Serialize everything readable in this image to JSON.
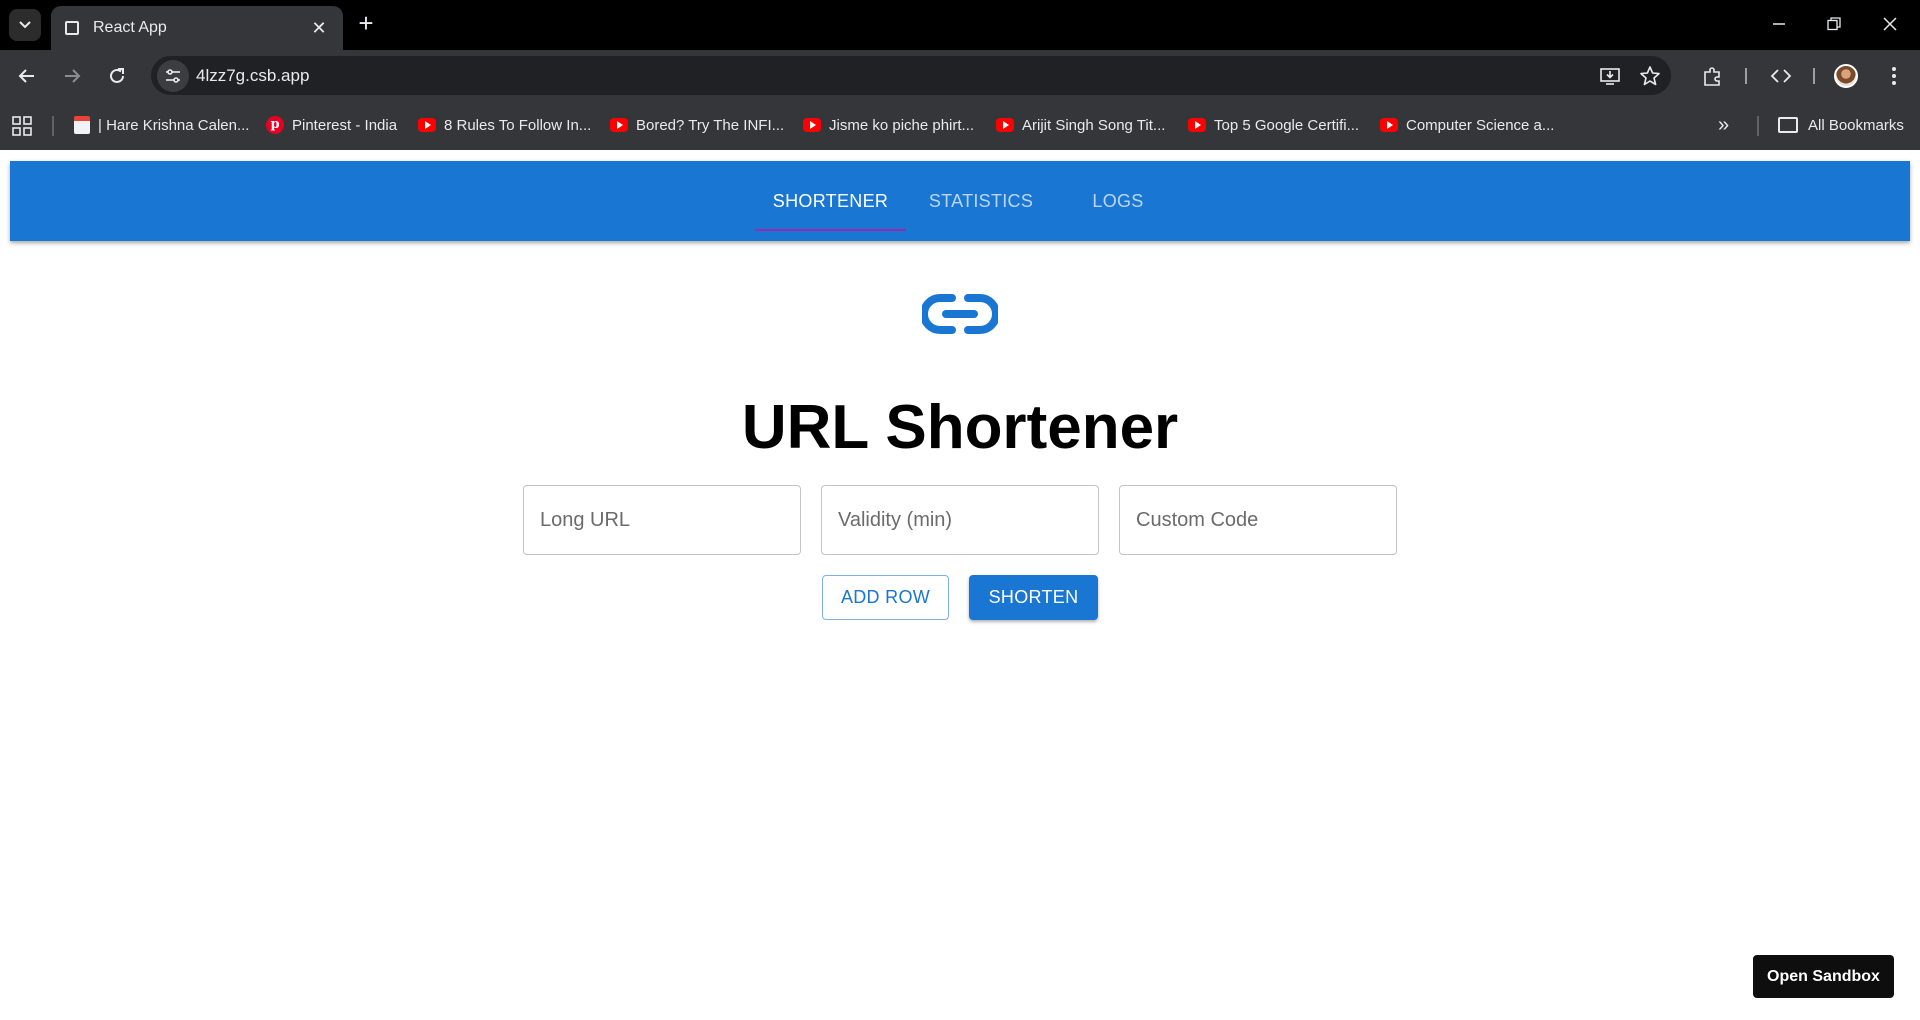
{
  "browser": {
    "tab_title": "React App",
    "url": "4lzz7g.csb.app",
    "bookmarks": [
      {
        "label": "| Hare Krishna Calen...",
        "icon": "calendar-icon"
      },
      {
        "label": "Pinterest - India",
        "icon": "pinterest-icon"
      },
      {
        "label": "8 Rules To Follow In...",
        "icon": "youtube-icon"
      },
      {
        "label": "Bored? Try The INFI...",
        "icon": "youtube-icon"
      },
      {
        "label": "Jisme ko piche phirt...",
        "icon": "youtube-icon"
      },
      {
        "label": "Arijit Singh Song Tit...",
        "icon": "youtube-icon"
      },
      {
        "label": "Top 5 Google Certifi...",
        "icon": "youtube-icon"
      },
      {
        "label": "Computer Science a...",
        "icon": "youtube-icon"
      }
    ],
    "all_bookmarks_label": "All Bookmarks"
  },
  "app": {
    "nav": {
      "tabs": [
        "SHORTENER",
        "STATISTICS",
        "LOGS"
      ],
      "active": "SHORTENER"
    },
    "logo_icon": "link-icon",
    "title": "URL Shortener",
    "form": {
      "long_url_placeholder": "Long URL",
      "validity_placeholder": "Validity (min)",
      "custom_code_placeholder": "Custom Code"
    },
    "add_row_label": "ADD ROW",
    "shorten_label": "SHORTEN"
  },
  "sandbox": {
    "open_label": "Open Sandbox"
  },
  "colors": {
    "primary": "#1976d2",
    "tab_indicator": "#9c27b0",
    "chrome_dark": "#35363a"
  }
}
